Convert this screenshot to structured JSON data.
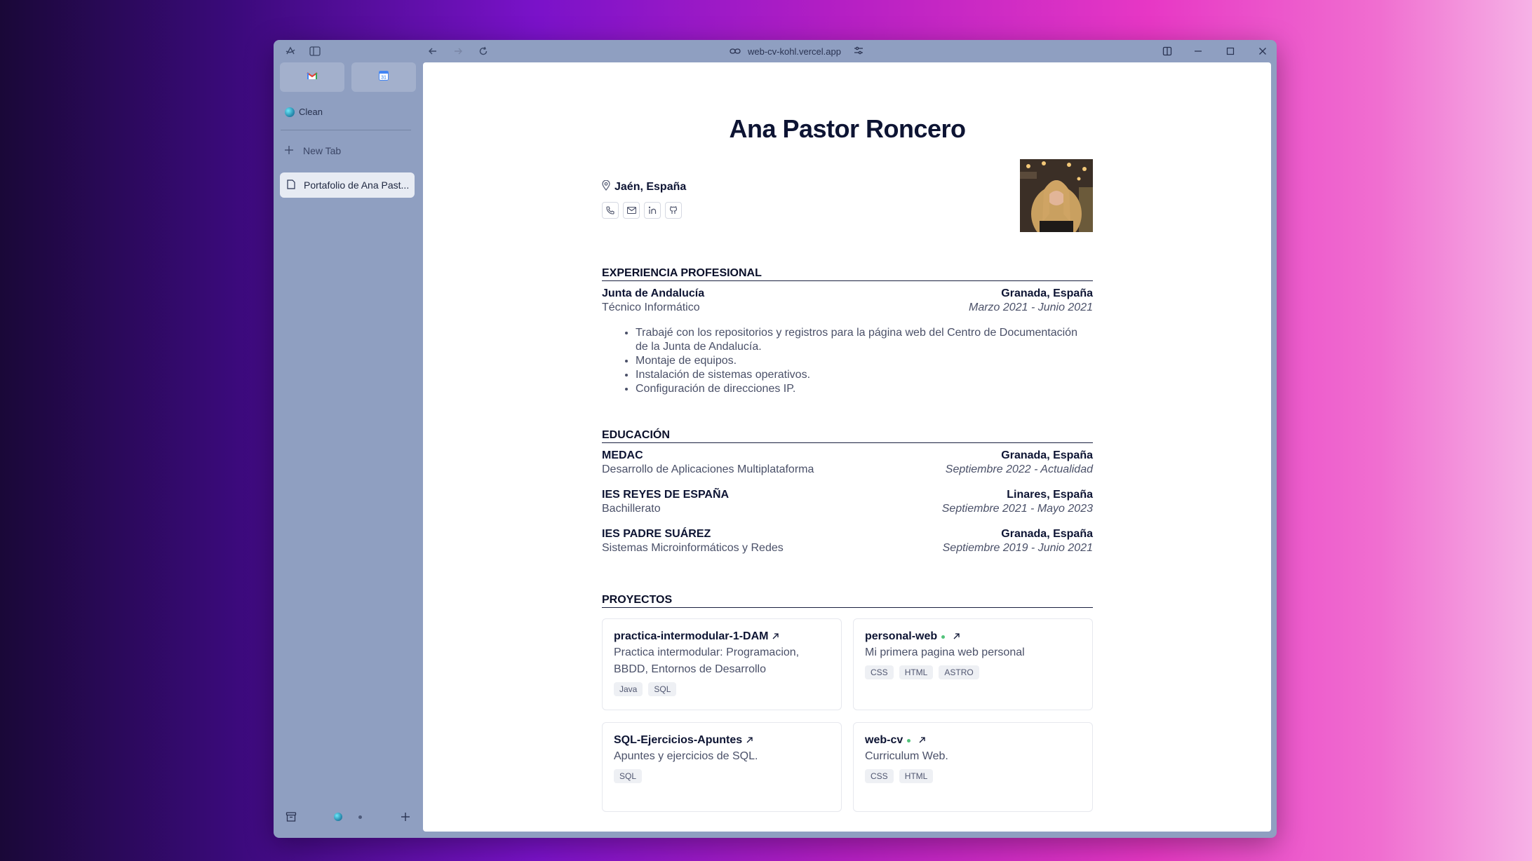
{
  "browser": {
    "url": "web-cv-kohl.vercel.app",
    "space_label": "Clean",
    "new_tab_label": "New Tab",
    "active_tab_label": "Portafolio de Ana Past..."
  },
  "cv": {
    "name": "Ana Pastor Roncero",
    "location": "Jaén, España",
    "experience": {
      "title": "EXPERIENCIA PROFESIONAL",
      "org": "Junta de Andalucía",
      "location": "Granada, España",
      "role": "Técnico Informático",
      "dates": "Marzo 2021 - Junio 2021",
      "bullets": [
        "Trabajé con los repositorios y registros para la página web del Centro de Documentación de la Junta de Andalucía.",
        "Montaje de equipos.",
        "Instalación de sistemas operativos.",
        "Configuración de direcciones IP."
      ]
    },
    "education": {
      "title": "EDUCACIÓN",
      "items": [
        {
          "org": "MEDAC",
          "location": "Granada, España",
          "role": "Desarrollo de Aplicaciones Multiplataforma",
          "dates": "Septiembre 2022 - Actualidad"
        },
        {
          "org": "IES REYES DE ESPAÑA",
          "location": "Linares, España",
          "role": "Bachillerato",
          "dates": "Septiembre 2021 - Mayo 2023"
        },
        {
          "org": "IES PADRE SUÁREZ",
          "location": "Granada, España",
          "role": "Sistemas Microinformáticos y Redes",
          "dates": "Septiembre 2019 - Junio 2021"
        }
      ]
    },
    "projects": {
      "title": "PROYECTOS",
      "items": [
        {
          "name": "practica-intermodular-1-DAM",
          "desc": "Practica intermodular: Programacion, BBDD, Entornos de Desarrollo",
          "tags": [
            "Java",
            "SQL"
          ]
        },
        {
          "name": "personal-web",
          "desc": "Mi primera pagina web personal",
          "tags": [
            "CSS",
            "HTML",
            "ASTRO"
          ]
        },
        {
          "name": "SQL-Ejercicios-Apuntes",
          "desc": "Apuntes y ejercicios de SQL.",
          "tags": [
            "SQL"
          ]
        },
        {
          "name": "web-cv",
          "desc": "Curriculum Web.",
          "tags": [
            "CSS",
            "HTML"
          ]
        }
      ]
    }
  },
  "colors": {
    "accent_dark": "#0d1433",
    "status_green": "#52c27a"
  }
}
